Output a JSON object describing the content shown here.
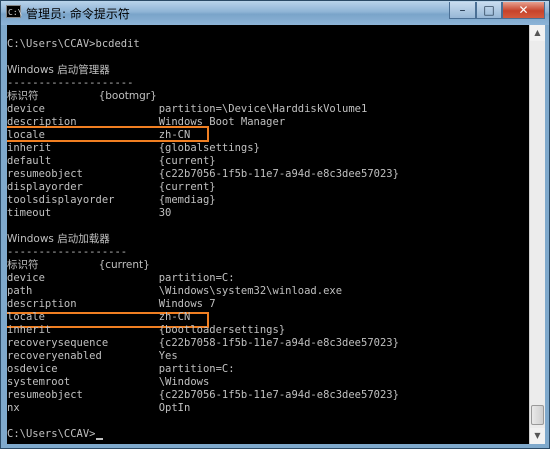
{
  "window": {
    "title": "管理员: 命令提示符",
    "icon_label": "C:\\",
    "minimize": "–",
    "maximize": "□",
    "close": "✕"
  },
  "console": {
    "lines": [
      "C:\\Users\\CCAV>bcdedit",
      "",
      "Windows 启动管理器",
      "--------------------",
      "标识符                  {bootmgr}",
      "device                  partition=\\Device\\HarddiskVolume1",
      "description             Windows Boot Manager",
      "locale                  zh-CN",
      "inherit                 {globalsettings}",
      "default                 {current}",
      "resumeobject            {c22b7056-1f5b-11e7-a94d-e8c3dee57023}",
      "displayorder            {current}",
      "toolsdisplayorder       {memdiag}",
      "timeout                 30",
      "",
      "Windows 启动加载器",
      "-------------------",
      "标识符                  {current}",
      "device                  partition=C:",
      "path                    \\Windows\\system32\\winload.exe",
      "description             Windows 7",
      "locale                  zh-CN",
      "inherit                 {bootloadersettings}",
      "recoverysequence        {c22b7058-1f5b-11e7-a94d-e8c3dee57023}",
      "recoveryenabled         Yes",
      "osdevice                partition=C:",
      "systemroot              \\Windows",
      "resumeobject            {c22b7056-1f5b-11e7-a94d-e8c3dee57023}",
      "nx                      OptIn",
      "",
      "C:\\Users\\CCAV>"
    ]
  },
  "colors": {
    "console_bg": "#000000",
    "console_text": "#c0c0c0",
    "highlight": "#f07f22"
  }
}
